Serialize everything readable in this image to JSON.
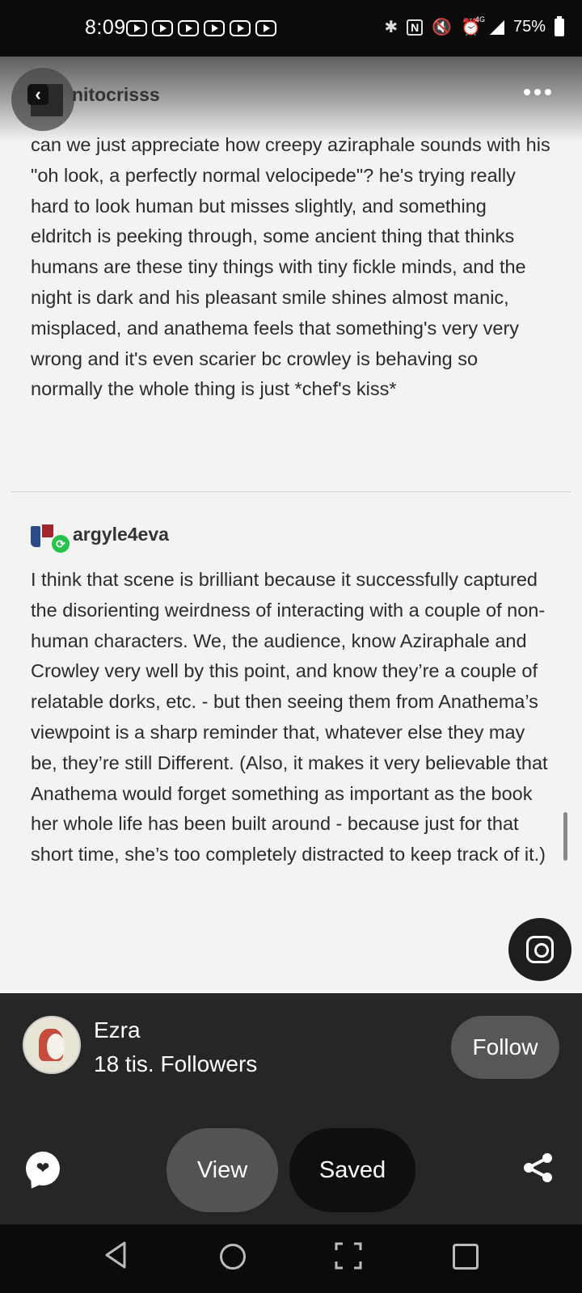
{
  "status_bar": {
    "time": "8:09",
    "battery": "75%",
    "network": "4G",
    "icons": [
      "youtube-notification-icon",
      "youtube-notification-icon",
      "youtube-notification-icon",
      "youtube-notification-icon",
      "youtube-notification-icon",
      "youtube-notification-icon",
      "bluetooth-icon",
      "nfc-icon",
      "mute-icon",
      "alarm-icon",
      "signal-icon",
      "battery-icon"
    ]
  },
  "header": {
    "username": "nitocrisss",
    "icons": [
      "back-icon",
      "more-icon"
    ]
  },
  "post": {
    "original_text": "can we just appreciate how creepy aziraphale sounds with his \"oh look, a perfectly normal velocipede\"? he's trying really hard to look human but misses slightly, and something eldritch is peeking through, some ancient thing that thinks humans are these tiny things with tiny fickle minds, and the night is dark and his pleasant smile shines almost manic, misplaced, and anathema feels that something's very very wrong and it's even scarier bc crowley is behaving so normally the whole thing is just *chef's kiss*",
    "reblog_username": "argyle4eva",
    "reblog_text": "I think that scene is brilliant because it successfully captured the disorienting weirdness of interacting with a couple of non-human characters. We, the audience, know Aziraphale and Crowley very well by this point, and know they’re a couple of relatable dorks, etc. - but then seeing them from Anathema’s viewpoint is a sharp reminder that, whatever else they may be, they’re still Different. (Also, it makes it very believable that Anathema would forget something as important as the book her whole life has been built around - because just for that short time, she’s too completely distracted to keep track of it.)"
  },
  "creator": {
    "name": "Ezra",
    "followers": "18 tis. Followers",
    "follow_label": "Follow"
  },
  "actions": {
    "view_label": "View",
    "saved_label": "Saved",
    "icons": [
      "comment-icon",
      "share-icon",
      "visual-search-icon"
    ]
  },
  "nav_bar": {
    "icons": [
      "nav-back-icon",
      "nav-home-icon",
      "nav-screenshot-icon",
      "nav-recents-icon"
    ]
  },
  "colors": {
    "page_background": "#f3f3f3",
    "panel_background": "#262626",
    "follow_button": "#575757",
    "view_button": "#535353",
    "saved_button": "#0f0f0f",
    "reblog_badge": "#27c24c"
  }
}
